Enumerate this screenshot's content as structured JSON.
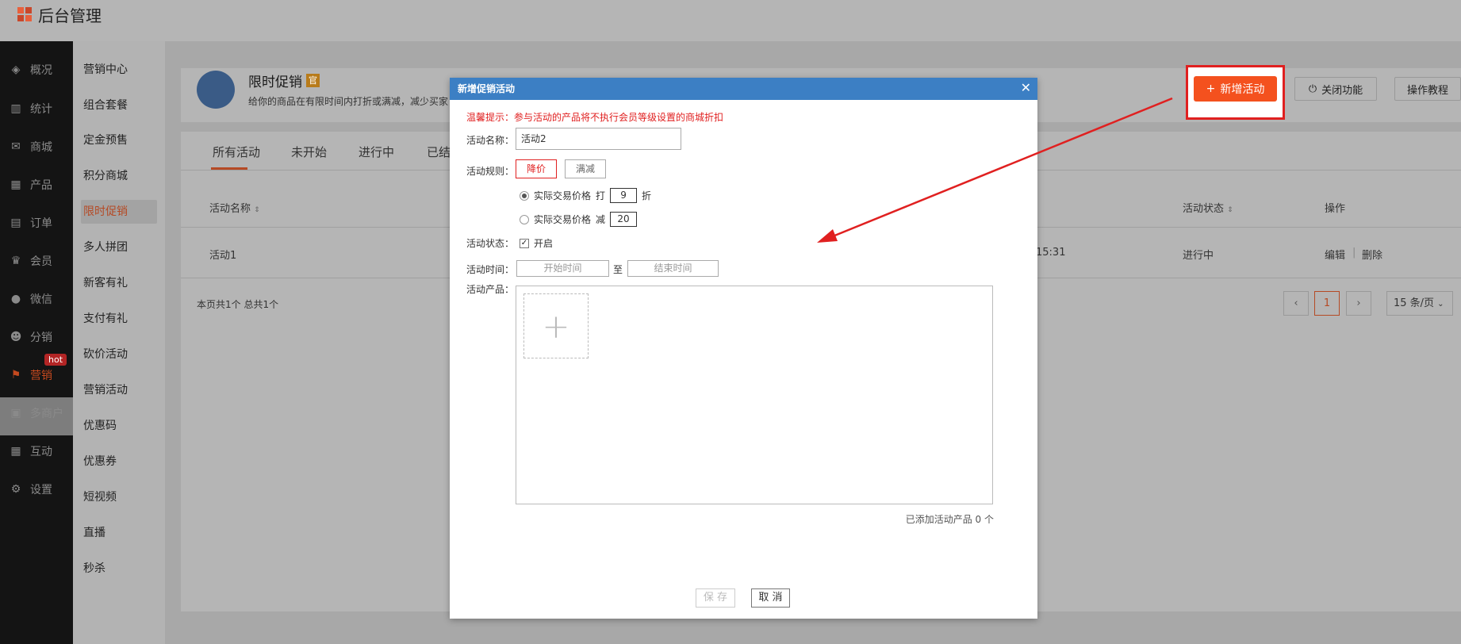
{
  "app": {
    "title": "后台管理"
  },
  "sidebar": {
    "items": [
      {
        "label": "概况",
        "icon": "layers-icon"
      },
      {
        "label": "统计",
        "icon": "chart-icon"
      },
      {
        "label": "商城",
        "icon": "mail-icon"
      },
      {
        "label": "产品",
        "icon": "grid-icon"
      },
      {
        "label": "订单",
        "icon": "clipboard-icon"
      },
      {
        "label": "会员",
        "icon": "crown-icon"
      },
      {
        "label": "微信",
        "icon": "wechat-icon"
      },
      {
        "label": "分销",
        "icon": "user-icon"
      },
      {
        "label": "营销",
        "icon": "flag-icon"
      },
      {
        "label": "多商户",
        "icon": "store-icon"
      },
      {
        "label": "互动",
        "icon": "grid-icon"
      },
      {
        "label": "设置",
        "icon": "gear-icon"
      }
    ],
    "hot_badge": "hot"
  },
  "subnav": {
    "items": [
      "营销中心",
      "组合套餐",
      "定金预售",
      "积分商城",
      "限时促销",
      "多人拼团",
      "新客有礼",
      "支付有礼",
      "砍价活动",
      "营销活动",
      "优惠码",
      "优惠券",
      "短视频",
      "直播",
      "秒杀"
    ]
  },
  "header": {
    "title": "限时促销",
    "badge": "官",
    "desc": "给你的商品在有限时间内打折或满减，减少买家",
    "add_button": "新增活动",
    "add_icon": "+",
    "close_feature": "关闭功能",
    "tutorial": "操作教程"
  },
  "tabs": [
    "所有活动",
    "未开始",
    "进行中",
    "已结"
  ],
  "table": {
    "columns": {
      "name": "活动名称",
      "status": "活动状态",
      "actions": "操作"
    },
    "rows": [
      {
        "name": "活动1",
        "time": "15:31",
        "status": "进行中",
        "edit": "编辑",
        "delete": "删除"
      }
    ],
    "summary": "本页共1个 总共1个"
  },
  "pagination": {
    "prev": "‹",
    "current": "1",
    "next": "›",
    "page_size": "15 条/页"
  },
  "modal": {
    "title": "新增促销活动",
    "close": "✕",
    "notice": "温馨提示：参与活动的产品将不执行会员等级设置的商城折扣",
    "name_label": "活动名称：",
    "name_value": "活动2",
    "rule_label": "活动规则：",
    "rule_discount": "降价",
    "rule_reduce": "满减",
    "option1": {
      "label": "实际交易价格",
      "prefix": "打",
      "value": "9",
      "suffix": "折"
    },
    "option2": {
      "label": "实际交易价格",
      "prefix": "减",
      "value": "20"
    },
    "status_label": "活动状态：",
    "status_value": "开启",
    "time_label": "活动时间：",
    "start_placeholder": "开始时间",
    "to": "至",
    "end_placeholder": "结束时间",
    "product_label": "活动产品：",
    "added_count": "已添加活动产品 0 个",
    "save": "保 存",
    "cancel": "取 消"
  },
  "colors": {
    "accent": "#f4511e",
    "modal_header": "#3c7fc4",
    "warning": "#e02020"
  }
}
